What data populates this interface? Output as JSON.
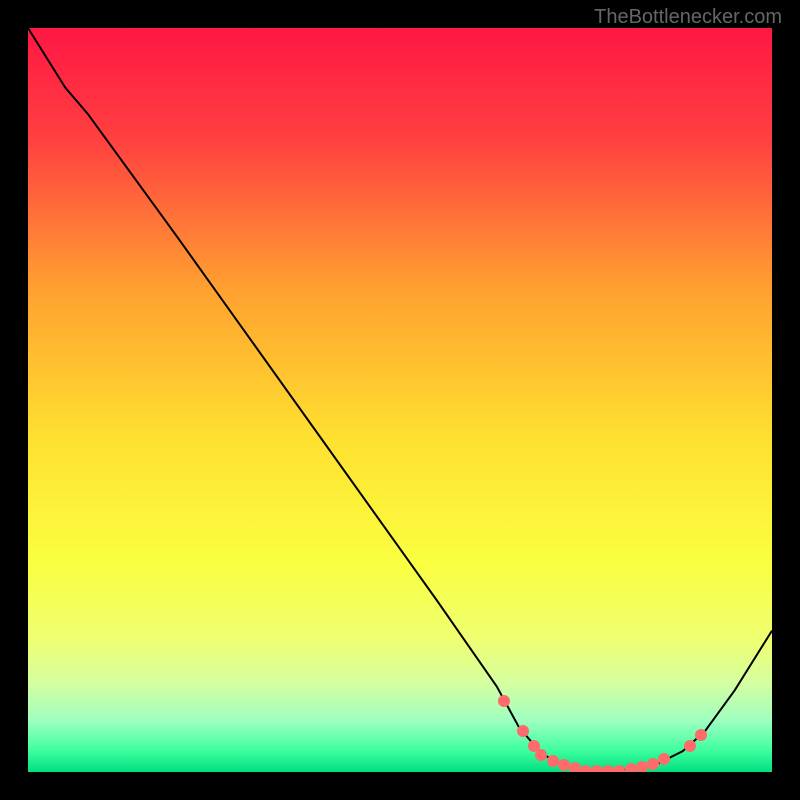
{
  "watermark": "TheBottlenecker.com",
  "chart_data": {
    "type": "line",
    "title": "",
    "xlabel": "",
    "ylabel": "",
    "xlim": [
      0,
      100
    ],
    "ylim": [
      0,
      100
    ],
    "background": {
      "type": "vertical-gradient",
      "stops": [
        {
          "pos": 0.0,
          "color": "#ff1744"
        },
        {
          "pos": 0.15,
          "color": "#ff4040"
        },
        {
          "pos": 0.35,
          "color": "#ffa030"
        },
        {
          "pos": 0.55,
          "color": "#ffe030"
        },
        {
          "pos": 0.72,
          "color": "#faff40"
        },
        {
          "pos": 0.82,
          "color": "#efff70"
        },
        {
          "pos": 0.88,
          "color": "#d5ffa0"
        },
        {
          "pos": 0.93,
          "color": "#a0ffc0"
        },
        {
          "pos": 0.97,
          "color": "#40ffa0"
        },
        {
          "pos": 1.0,
          "color": "#00e080"
        }
      ]
    },
    "series": [
      {
        "name": "curve",
        "color": "#000000",
        "width": 2,
        "points": [
          {
            "x": 0,
            "y": 100
          },
          {
            "x": 5,
            "y": 92
          },
          {
            "x": 8,
            "y": 88.5
          },
          {
            "x": 20,
            "y": 72
          },
          {
            "x": 40,
            "y": 44
          },
          {
            "x": 55,
            "y": 23
          },
          {
            "x": 63,
            "y": 11.5
          },
          {
            "x": 66,
            "y": 6
          },
          {
            "x": 69,
            "y": 2.5
          },
          {
            "x": 72,
            "y": 0.8
          },
          {
            "x": 78,
            "y": 0
          },
          {
            "x": 84,
            "y": 0.8
          },
          {
            "x": 88,
            "y": 2.8
          },
          {
            "x": 91,
            "y": 5.5
          },
          {
            "x": 95,
            "y": 11
          },
          {
            "x": 100,
            "y": 19
          }
        ]
      }
    ],
    "dots": {
      "color": "#ff6b6b",
      "radius": 6,
      "points": [
        {
          "x": 64,
          "y": 9.5
        },
        {
          "x": 66.5,
          "y": 5.5
        },
        {
          "x": 68,
          "y": 3.5
        },
        {
          "x": 69,
          "y": 2.3
        },
        {
          "x": 70.5,
          "y": 1.5
        },
        {
          "x": 72,
          "y": 0.9
        },
        {
          "x": 73.5,
          "y": 0.5
        },
        {
          "x": 75,
          "y": 0.2
        },
        {
          "x": 76.5,
          "y": 0.1
        },
        {
          "x": 78,
          "y": 0.1
        },
        {
          "x": 79.5,
          "y": 0.2
        },
        {
          "x": 81,
          "y": 0.4
        },
        {
          "x": 82.5,
          "y": 0.7
        },
        {
          "x": 84,
          "y": 1.1
        },
        {
          "x": 85.5,
          "y": 1.7
        },
        {
          "x": 89,
          "y": 3.5
        },
        {
          "x": 90.5,
          "y": 5
        }
      ]
    }
  }
}
